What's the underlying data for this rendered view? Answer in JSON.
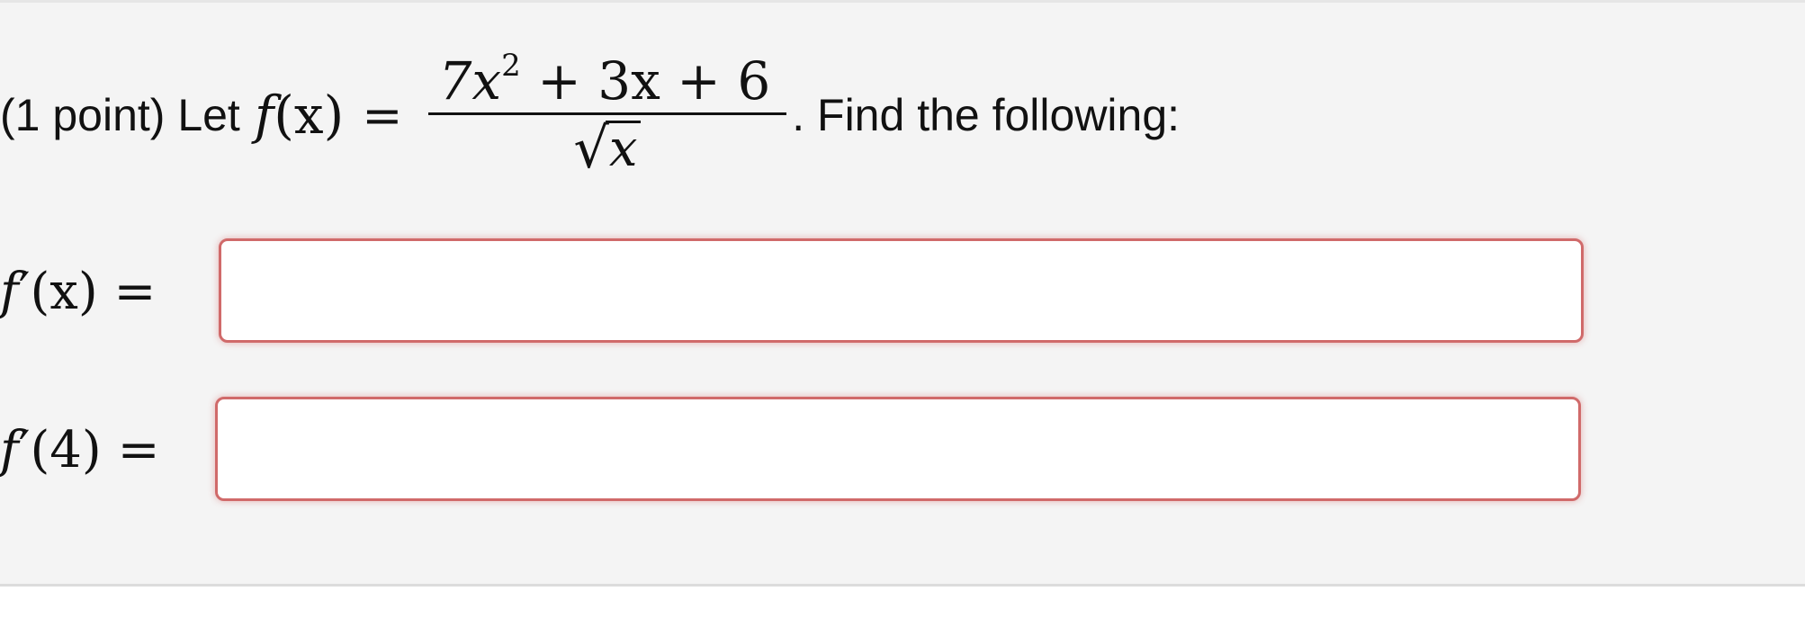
{
  "problem": {
    "prefix": "(1 point) Let",
    "function_name": "f",
    "function_arg": "(x)",
    "equals": "=",
    "numerator_a": "7x",
    "numerator_exp": "2",
    "numerator_b": " + 3x + 6",
    "radical_symbol": "√",
    "denominator_radicand": "x",
    "suffix": ". Find the following:"
  },
  "answers": [
    {
      "label_fn": "f",
      "label_prime": "′",
      "label_arg": "(x)",
      "label_eq": "=",
      "value": ""
    },
    {
      "label_fn": "f",
      "label_prime": "′",
      "label_arg": "(4)",
      "label_eq": "=",
      "value": ""
    }
  ],
  "colors": {
    "panel_background": "#f4f4f4",
    "input_border_error": "#d06a6a"
  }
}
